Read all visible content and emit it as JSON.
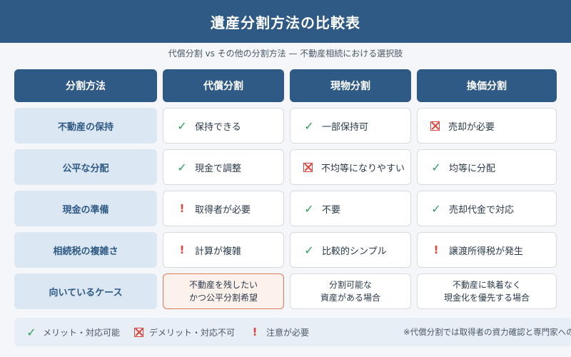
{
  "title": "遺産分割方法の比較表",
  "subtitle": "代償分割 vs その他の分割方法 — 不動産相続における選択肢",
  "columns": [
    "分割方法",
    "代償分割",
    "現物分割",
    "換価分割"
  ],
  "rows": [
    {
      "label": "不動産の保持",
      "cells": [
        {
          "icon": "check-icon",
          "text": "保持できる"
        },
        {
          "icon": "check-icon",
          "text": "一部保持可"
        },
        {
          "icon": "cross-box-icon",
          "text": "売却が必要"
        }
      ]
    },
    {
      "label": "公平な分配",
      "cells": [
        {
          "icon": "check-icon",
          "text": "現金で調整"
        },
        {
          "icon": "cross-box-icon",
          "text": "不均等になりやすい"
        },
        {
          "icon": "check-icon",
          "text": "均等に分配"
        }
      ]
    },
    {
      "label": "現金の準備",
      "cells": [
        {
          "icon": "exclamation-icon",
          "text": "取得者が必要"
        },
        {
          "icon": "check-icon",
          "text": "不要"
        },
        {
          "icon": "check-icon",
          "text": "売却代金で対応"
        }
      ]
    },
    {
      "label": "相続税の複雑さ",
      "cells": [
        {
          "icon": "exclamation-icon",
          "text": "計算が複雑"
        },
        {
          "icon": "check-icon",
          "text": "比較的シンプル"
        },
        {
          "icon": "exclamation-icon",
          "text": "譲渡所得税が発生"
        }
      ]
    },
    {
      "label": "向いているケース",
      "cells": [
        {
          "line1": "不動産を残したい",
          "line2": "かつ公平分割希望"
        },
        {
          "line1": "分割可能な",
          "line2": "資産がある場合"
        },
        {
          "line1": "不動産に執着なく",
          "line2": "現金化を優先する場合"
        }
      ]
    }
  ],
  "legend": {
    "ok": "メリット・対応可能",
    "ng": "デメリット・対応不可",
    "warn": "注意が必要",
    "note": "※代償分割では取得者の資力確認と専門家への相談が重要"
  },
  "colors": {
    "primary": "#2f5a85",
    "row_header_bg": "#dbe7f3",
    "ok": "#2e9e5b",
    "ng": "#d9453a",
    "highlight_border": "#e07a5f"
  }
}
